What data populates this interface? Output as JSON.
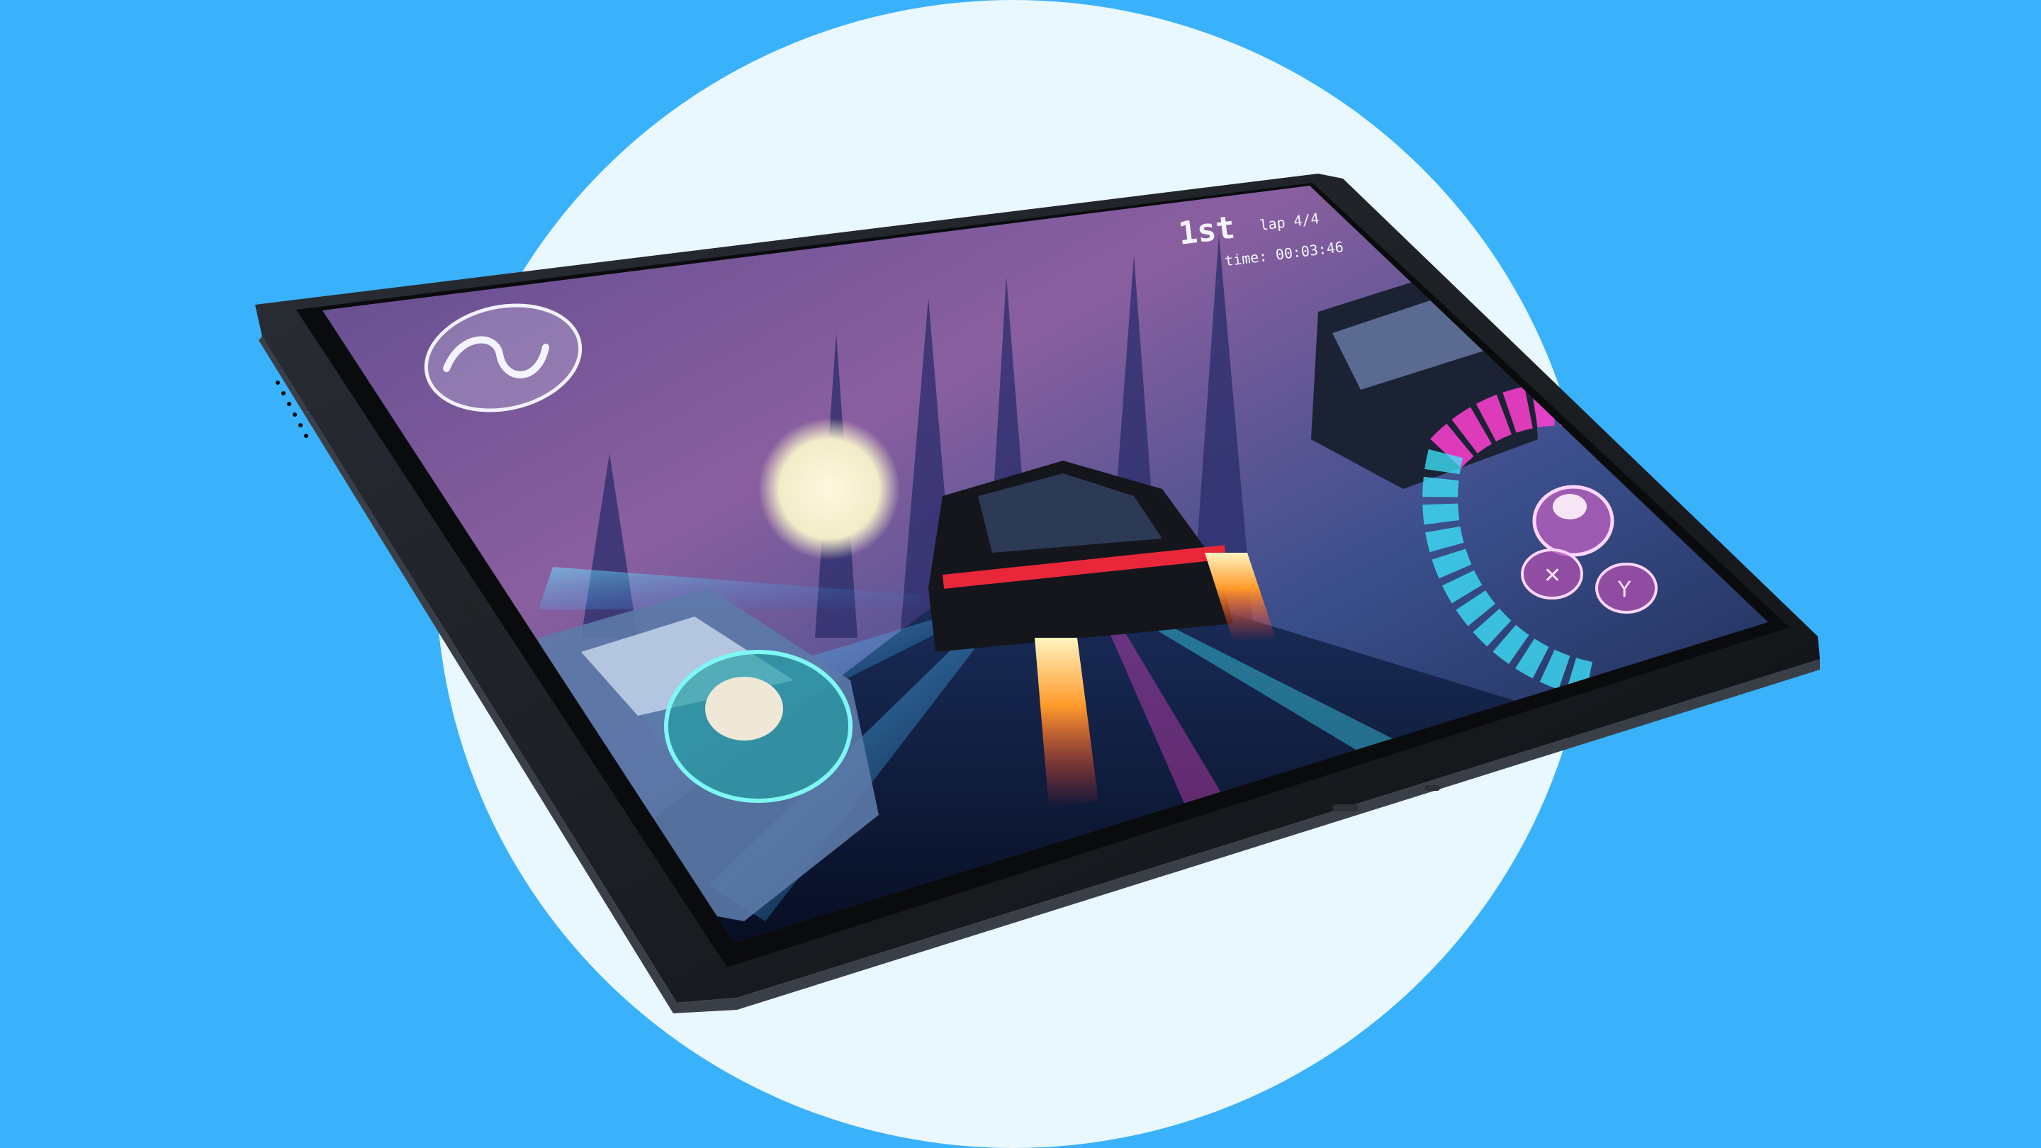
{
  "scene": {
    "colors": {
      "background": "#39b1fb",
      "circle": "#e9f7ff",
      "tablet_body": "#1c1f24",
      "screen_sky_top": "#6f5aa8",
      "neon_pink": "#ff3fd2",
      "neon_cyan": "#3ee8ff"
    }
  },
  "hud": {
    "position": "1st",
    "lap": "lap 4/4",
    "time": "time: 00:03:46"
  },
  "controls": {
    "logo_icon": "track-wave-icon",
    "joystick_icon": "joystick-thumb-icon",
    "buttons": [
      {
        "name": "action-button-top",
        "glyph": ""
      },
      {
        "name": "action-button-x",
        "glyph": "✕"
      },
      {
        "name": "action-button-y",
        "glyph": "Y"
      }
    ],
    "speed_gauge_icon": "speed-gauge-icon"
  }
}
